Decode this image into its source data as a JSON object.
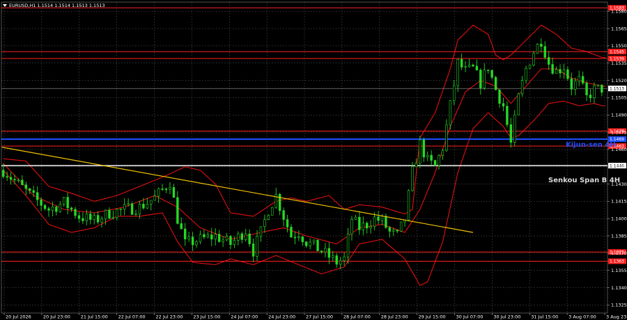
{
  "chart_data": {
    "type": "candlestick",
    "title": "EURUSD,H1  1.1514 1.1514 1.1513 1.1513",
    "symbol": "EURUSD",
    "timeframe": "H1",
    "ohlc": [
      1.1514,
      1.1514,
      1.1513,
      1.1513
    ],
    "ylim": [
      1.1318,
      1.1588
    ],
    "y_ticks": [
      1.1325,
      1.134,
      1.1355,
      1.137,
      1.1385,
      1.14,
      1.1415,
      1.143,
      1.1445,
      1.146,
      1.1475,
      1.149,
      1.1505,
      1.152,
      1.1535,
      1.155,
      1.1565,
      1.158
    ],
    "x_ticks": [
      "20 Jul 2026",
      "20 Jul 23:00",
      "21 Jul 15:00",
      "22 Jul 07:00",
      "22 Jul 23:00",
      "23 Jul 15:00",
      "24 Jul 07:00",
      "24 Jul 23:00",
      "27 Jul 15:00",
      "28 Jul 07:00",
      "28 Jul 23:00",
      "29 Jul 15:00",
      "30 Jul 07:00",
      "30 Jul 23:00",
      "31 Jul 15:00",
      "3 Aug 07:00",
      "3 Aug 23:00"
    ],
    "grid": true,
    "price_levels": [
      {
        "value": 1.1583,
        "color": "#ff2020",
        "label": "1.1583"
      },
      {
        "value": 1.1545,
        "color": "#ff2020",
        "label": "1.1545"
      },
      {
        "value": 1.1539,
        "color": "#ff2020",
        "label": "1.1539"
      },
      {
        "value": 1.1476,
        "color": "#ff2020",
        "label": "1.1476"
      },
      {
        "value": 1.1463,
        "color": "#ff2020",
        "label": "1.1463"
      },
      {
        "value": 1.1469,
        "color": "#1f4fff",
        "label": "1.1469",
        "name": "Kijun-sen 4H"
      },
      {
        "value": 1.1446,
        "color": "#e6e6e6",
        "label": "1.1446",
        "name": "Senkou Span B 4H"
      },
      {
        "value": 1.1371,
        "color": "#ff2020",
        "label": "1.1371"
      },
      {
        "value": 1.1363,
        "color": "#ff2020",
        "label": "1.1363"
      }
    ],
    "current_price": {
      "value": 1.1513,
      "label": "1.1513"
    },
    "indicator_labels": {
      "kijun": "Kijun-sen 4H",
      "senkou": "Senkou Span B 4H"
    },
    "trendline": {
      "start": [
        0,
        1.1462
      ],
      "end": [
        124,
        1.1388
      ],
      "color": "#f2c200"
    },
    "close_path": [
      [
        0,
        1.1442
      ],
      [
        4,
        1.143
      ],
      [
        8,
        1.1418
      ],
      [
        12,
        1.1408
      ],
      [
        16,
        1.1414
      ],
      [
        20,
        1.1402
      ],
      [
        24,
        1.1398
      ],
      [
        28,
        1.1405
      ],
      [
        32,
        1.1408
      ],
      [
        36,
        1.141
      ],
      [
        40,
        1.1418
      ],
      [
        44,
        1.1432
      ],
      [
        46,
        1.14
      ],
      [
        48,
        1.1378
      ],
      [
        52,
        1.1382
      ],
      [
        56,
        1.1385
      ],
      [
        60,
        1.1378
      ],
      [
        64,
        1.139
      ],
      [
        66,
        1.1372
      ],
      [
        68,
        1.1388
      ],
      [
        70,
        1.1408
      ],
      [
        72,
        1.142
      ],
      [
        74,
        1.1402
      ],
      [
        76,
        1.1385
      ],
      [
        78,
        1.1388
      ],
      [
        80,
        1.138
      ],
      [
        84,
        1.1372
      ],
      [
        88,
        1.1362
      ],
      [
        90,
        1.1365
      ],
      [
        92,
        1.14
      ],
      [
        94,
        1.1392
      ],
      [
        96,
        1.1395
      ],
      [
        98,
        1.14
      ],
      [
        100,
        1.1398
      ],
      [
        102,
        1.1388
      ],
      [
        104,
        1.1385
      ],
      [
        106,
        1.14
      ],
      [
        108,
        1.144
      ],
      [
        110,
        1.1465
      ],
      [
        112,
        1.145
      ],
      [
        114,
        1.1445
      ],
      [
        116,
        1.1462
      ],
      [
        118,
        1.1498
      ],
      [
        120,
        1.1535
      ],
      [
        122,
        1.1528
      ],
      [
        124,
        1.153
      ],
      [
        126,
        1.1518
      ],
      [
        128,
        1.1532
      ],
      [
        130,
        1.1512
      ],
      [
        132,
        1.1498
      ],
      [
        134,
        1.1465
      ],
      [
        136,
        1.1505
      ],
      [
        138,
        1.153
      ],
      [
        140,
        1.1545
      ],
      [
        142,
        1.1555
      ],
      [
        144,
        1.1535
      ],
      [
        146,
        1.1528
      ],
      [
        148,
        1.1532
      ],
      [
        150,
        1.1515
      ],
      [
        152,
        1.152
      ],
      [
        154,
        1.1505
      ],
      [
        156,
        1.1512
      ],
      [
        158,
        1.1513
      ]
    ],
    "bands": {
      "upper": [
        [
          0,
          1.1452
        ],
        [
          6,
          1.145
        ],
        [
          12,
          1.1428
        ],
        [
          18,
          1.1422
        ],
        [
          24,
          1.1415
        ],
        [
          30,
          1.142
        ],
        [
          36,
          1.1428
        ],
        [
          42,
          1.1436
        ],
        [
          48,
          1.1445
        ],
        [
          52,
          1.1442
        ],
        [
          56,
          1.143
        ],
        [
          60,
          1.1405
        ],
        [
          66,
          1.1402
        ],
        [
          72,
          1.1415
        ],
        [
          76,
          1.1418
        ],
        [
          80,
          1.1415
        ],
        [
          86,
          1.142
        ],
        [
          90,
          1.1408
        ],
        [
          94,
          1.1412
        ],
        [
          100,
          1.141
        ],
        [
          106,
          1.1404
        ],
        [
          108,
          1.1408
        ],
        [
          110,
          1.147
        ],
        [
          114,
          1.1492
        ],
        [
          118,
          1.153
        ],
        [
          120,
          1.1555
        ],
        [
          124,
          1.1568
        ],
        [
          128,
          1.156
        ],
        [
          130,
          1.1542
        ],
        [
          132,
          1.1538
        ],
        [
          134,
          1.1542
        ],
        [
          138,
          1.1555
        ],
        [
          142,
          1.1568
        ],
        [
          146,
          1.156
        ],
        [
          150,
          1.1548
        ],
        [
          154,
          1.1545
        ],
        [
          158,
          1.154
        ]
      ],
      "lower": [
        [
          0,
          1.1442
        ],
        [
          6,
          1.142
        ],
        [
          12,
          1.1395
        ],
        [
          18,
          1.1388
        ],
        [
          24,
          1.1392
        ],
        [
          30,
          1.1402
        ],
        [
          36,
          1.1402
        ],
        [
          42,
          1.1405
        ],
        [
          46,
          1.138
        ],
        [
          50,
          1.1362
        ],
        [
          56,
          1.136
        ],
        [
          60,
          1.1365
        ],
        [
          66,
          1.136
        ],
        [
          72,
          1.1368
        ],
        [
          78,
          1.136
        ],
        [
          84,
          1.1352
        ],
        [
          90,
          1.1358
        ],
        [
          94,
          1.1378
        ],
        [
          100,
          1.1382
        ],
        [
          106,
          1.1365
        ],
        [
          110,
          1.1342
        ],
        [
          112,
          1.1345
        ],
        [
          116,
          1.138
        ],
        [
          120,
          1.144
        ],
        [
          124,
          1.1478
        ],
        [
          128,
          1.1492
        ],
        [
          132,
          1.148
        ],
        [
          134,
          1.147
        ],
        [
          136,
          1.1472
        ],
        [
          140,
          1.1485
        ],
        [
          144,
          1.15
        ],
        [
          148,
          1.1502
        ],
        [
          152,
          1.1498
        ],
        [
          156,
          1.15
        ],
        [
          158,
          1.1498
        ]
      ],
      "middle": [
        [
          0,
          1.1448
        ],
        [
          8,
          1.142
        ],
        [
          16,
          1.1408
        ],
        [
          24,
          1.1405
        ],
        [
          32,
          1.141
        ],
        [
          40,
          1.142
        ],
        [
          46,
          1.141
        ],
        [
          52,
          1.1392
        ],
        [
          60,
          1.1382
        ],
        [
          68,
          1.1388
        ],
        [
          74,
          1.1392
        ],
        [
          80,
          1.1385
        ],
        [
          88,
          1.1378
        ],
        [
          94,
          1.1392
        ],
        [
          100,
          1.1395
        ],
        [
          106,
          1.1388
        ],
        [
          110,
          1.1408
        ],
        [
          114,
          1.144
        ],
        [
          118,
          1.148
        ],
        [
          122,
          1.151
        ],
        [
          126,
          1.152
        ],
        [
          130,
          1.1515
        ],
        [
          134,
          1.15
        ],
        [
          138,
          1.1515
        ],
        [
          142,
          1.153
        ],
        [
          146,
          1.153
        ],
        [
          150,
          1.1522
        ],
        [
          154,
          1.1518
        ],
        [
          158,
          1.1515
        ]
      ]
    }
  }
}
